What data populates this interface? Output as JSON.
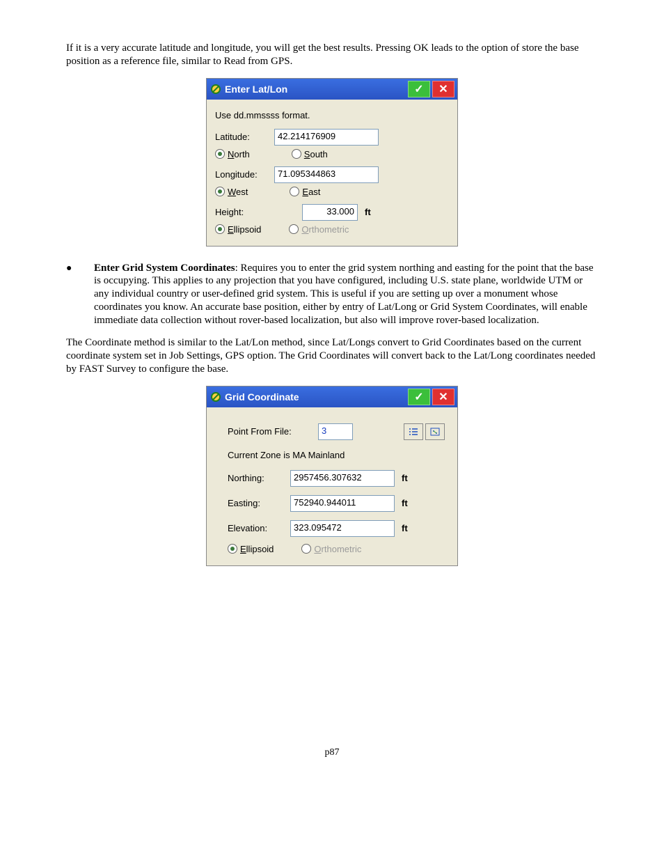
{
  "intro": "If it is a very accurate latitude and longitude, you will get the best results. Pressing OK leads to the option of store the base position as a reference file, similar to Read from GPS.",
  "panel1": {
    "title": "Enter Lat/Lon",
    "hint": "Use dd.mmssss format.",
    "lat_label": "Latitude:",
    "lat_value": "42.214176909",
    "north": "North",
    "south": "South",
    "lon_label": "Longitude:",
    "lon_value": "71.095344863",
    "west": "West",
    "east": "East",
    "height_label": "Height:",
    "height_value": "33.000",
    "height_unit": "ft",
    "ellipsoid": "Ellipsoid",
    "ortho": "Orthometric"
  },
  "bullet": {
    "title": "Enter Grid System Coordinates",
    "text": ": Requires you to enter the grid system northing and easting for the point that the base is occupying.  This applies to any projection that you have configured, including U.S. state plane, worldwide UTM or any individual country or user-defined grid system.  This is useful if you are setting up over a monument whose coordinates you know.   An accurate base position, either by entry of Lat/Long or Grid System Coordinates, will enable immediate data collection without rover-based localization, but also will improve rover-based localization."
  },
  "para2": "The Coordinate method is similar to the Lat/Lon method, since Lat/Longs convert to Grid Coordinates based on the current  coordinate system set in Job Settings, GPS option.  The Grid Coordinates will convert back to the Lat/Long coordinates needed by FAST Survey to configure the base.",
  "panel2": {
    "title": "Grid Coordinate",
    "pt_label": "Point From File:",
    "pt_value": "3",
    "zone": "Current Zone is  MA Mainland",
    "northing_label": "Northing:",
    "northing_value": "2957456.307632",
    "easting_label": "Easting:",
    "easting_value": "752940.944011",
    "elev_label": "Elevation:",
    "elev_value": "323.095472",
    "unit": "ft",
    "ellipsoid": "Ellipsoid",
    "ortho": "Orthometric"
  },
  "page": "p87"
}
